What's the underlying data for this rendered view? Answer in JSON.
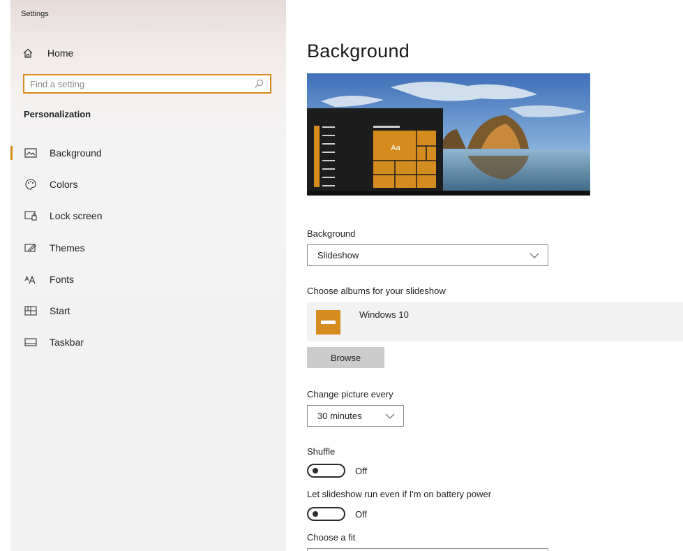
{
  "app": {
    "title": "Settings"
  },
  "sidebar": {
    "home_label": "Home",
    "search_placeholder": "Find a setting",
    "section_title": "Personalization",
    "items": [
      {
        "label": "Background",
        "icon": "picture-icon",
        "active": true
      },
      {
        "label": "Colors",
        "icon": "palette-icon",
        "active": false
      },
      {
        "label": "Lock screen",
        "icon": "lock-screen-icon",
        "active": false
      },
      {
        "label": "Themes",
        "icon": "themes-icon",
        "active": false
      },
      {
        "label": "Fonts",
        "icon": "fonts-icon",
        "active": false
      },
      {
        "label": "Start",
        "icon": "start-icon",
        "active": false
      },
      {
        "label": "Taskbar",
        "icon": "taskbar-icon",
        "active": false
      }
    ]
  },
  "main": {
    "title": "Background",
    "preview": {
      "tile_text": "Aa"
    },
    "background": {
      "label": "Background",
      "value": "Slideshow"
    },
    "albums": {
      "label": "Choose albums for your slideshow",
      "album_name": "Windows 10",
      "browse_label": "Browse"
    },
    "interval": {
      "label": "Change picture every",
      "value": "30 minutes"
    },
    "shuffle": {
      "label": "Shuffle",
      "state": "Off"
    },
    "battery": {
      "label": "Let slideshow run even if I'm on battery power",
      "state": "Off"
    },
    "fit": {
      "label": "Choose a fit"
    }
  },
  "colors": {
    "accent": "#d58c1f",
    "sidebar_bg": "#f2f2f2",
    "album_bg": "#f2f2f2",
    "button_bg": "#cccccc"
  }
}
